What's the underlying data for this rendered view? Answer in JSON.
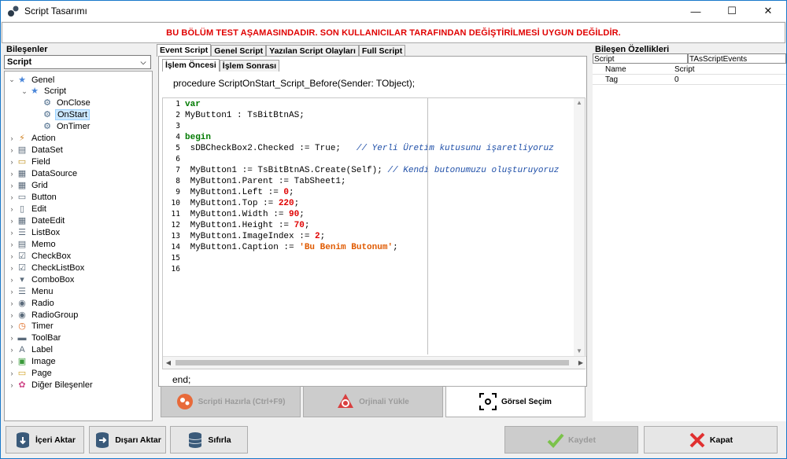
{
  "window": {
    "title": "Script Tasarımı",
    "minimize": "—",
    "maximize": "☐",
    "close": "✕"
  },
  "warning": "BU BÖLÜM TEST AŞAMASINDADIR. SON KULLANICILAR TARAFINDAN DEĞİŞTİRİLMESİ UYGUN DEĞİLDİR.",
  "warning_color": "#e00000",
  "components": {
    "label": "Bileşenler",
    "combo_value": "Script",
    "tree": [
      {
        "label": "Genel",
        "level": 0,
        "expanded": true,
        "icon": "star-icon"
      },
      {
        "label": "Script",
        "level": 1,
        "expanded": true,
        "icon": "star-icon"
      },
      {
        "label": "OnClose",
        "level": 2,
        "icon": "event-icon"
      },
      {
        "label": "OnStart",
        "level": 2,
        "icon": "event-icon",
        "selected": true
      },
      {
        "label": "OnTimer",
        "level": 2,
        "icon": "event-icon"
      },
      {
        "label": "Action",
        "level": 0,
        "icon": "action-icon"
      },
      {
        "label": "DataSet",
        "level": 0,
        "icon": "dataset-icon"
      },
      {
        "label": "Field",
        "level": 0,
        "icon": "field-icon"
      },
      {
        "label": "DataSource",
        "level": 0,
        "icon": "datasource-icon"
      },
      {
        "label": "Grid",
        "level": 0,
        "icon": "grid-icon"
      },
      {
        "label": "Button",
        "level": 0,
        "icon": "button-icon"
      },
      {
        "label": "Edit",
        "level": 0,
        "icon": "edit-icon"
      },
      {
        "label": "DateEdit",
        "level": 0,
        "icon": "dateedit-icon"
      },
      {
        "label": "ListBox",
        "level": 0,
        "icon": "listbox-icon"
      },
      {
        "label": "Memo",
        "level": 0,
        "icon": "memo-icon"
      },
      {
        "label": "CheckBox",
        "level": 0,
        "icon": "checkbox-icon"
      },
      {
        "label": "CheckListBox",
        "level": 0,
        "icon": "checklistbox-icon"
      },
      {
        "label": "ComboBox",
        "level": 0,
        "icon": "combobox-icon"
      },
      {
        "label": "Menu",
        "level": 0,
        "icon": "menu-icon"
      },
      {
        "label": "Radio",
        "level": 0,
        "icon": "radio-icon"
      },
      {
        "label": "RadioGroup",
        "level": 0,
        "icon": "radiogroup-icon"
      },
      {
        "label": "Timer",
        "level": 0,
        "icon": "timer-icon"
      },
      {
        "label": "ToolBar",
        "level": 0,
        "icon": "toolbar-icon"
      },
      {
        "label": "Label",
        "level": 0,
        "icon": "label-icon"
      },
      {
        "label": "Image",
        "level": 0,
        "icon": "image-icon"
      },
      {
        "label": "Page",
        "level": 0,
        "icon": "page-icon"
      },
      {
        "label": "Diğer Bileşenler",
        "level": 0,
        "icon": "other-components-icon"
      }
    ]
  },
  "center": {
    "tabs": [
      "Event Script",
      "Genel Script",
      "Yazılan Script Olayları",
      "Full Script"
    ],
    "subtabs": [
      "İşlem Öncesi",
      "İşlem Sonrası"
    ],
    "procedure": "procedure ScriptOnStart_Script_Before(Sender: TObject);",
    "line_numbers": [
      "1",
      "2",
      "3",
      "4",
      "5",
      "6",
      "7",
      "8",
      "9",
      "10",
      "11",
      "12",
      "13",
      "14",
      "15",
      "16"
    ],
    "code_lines": [
      [
        {
          "t": "var",
          "c": "kw"
        }
      ],
      [
        {
          "t": "MyButton1 : TsBitBtnAS;",
          "c": ""
        }
      ],
      [],
      [
        {
          "t": "begin",
          "c": "kw"
        }
      ],
      [
        {
          "t": " sDBCheckBox2.Checked := True;   ",
          "c": ""
        },
        {
          "t": "// Yerli Üretim kutusunu işaretliyoruz",
          "c": "cmt"
        }
      ],
      [],
      [
        {
          "t": " MyButton1 := TsBitBtnAS.Create(Self); ",
          "c": ""
        },
        {
          "t": "// Kendi butonumuzu oluşturuyoruz",
          "c": "cmt"
        }
      ],
      [
        {
          "t": " MyButton1.Parent := TabSheet1;",
          "c": ""
        }
      ],
      [
        {
          "t": " MyButton1.Left := ",
          "c": ""
        },
        {
          "t": "0",
          "c": "num"
        },
        {
          "t": ";",
          "c": ""
        }
      ],
      [
        {
          "t": " MyButton1.Top := ",
          "c": ""
        },
        {
          "t": "220",
          "c": "num"
        },
        {
          "t": ";",
          "c": ""
        }
      ],
      [
        {
          "t": " MyButton1.Width := ",
          "c": ""
        },
        {
          "t": "90",
          "c": "num"
        },
        {
          "t": ";",
          "c": ""
        }
      ],
      [
        {
          "t": " MyButton1.Height := ",
          "c": ""
        },
        {
          "t": "70",
          "c": "num"
        },
        {
          "t": ";",
          "c": ""
        }
      ],
      [
        {
          "t": " MyButton1.ImageIndex := ",
          "c": ""
        },
        {
          "t": "2",
          "c": "num"
        },
        {
          "t": ";",
          "c": ""
        }
      ],
      [
        {
          "t": " MyButton1.Caption := ",
          "c": ""
        },
        {
          "t": "'Bu Benim Butonum'",
          "c": "str"
        },
        {
          "t": ";",
          "c": ""
        }
      ],
      [],
      []
    ],
    "end_text": "end;",
    "btn_prepare": "Scripti Hazırla (Ctrl+F9)",
    "btn_restore": "Orjinali Yükle",
    "btn_visual": "Görsel Seçim"
  },
  "properties": {
    "label": "Bileşen Özellikleri",
    "header_left": "Script",
    "header_right": "TAsScriptEvents",
    "rows": [
      {
        "name": "Name",
        "value": "Script"
      },
      {
        "name": "Tag",
        "value": "0"
      }
    ]
  },
  "bottom": {
    "import": "İçeri Aktar",
    "export": "Dışarı Aktar",
    "reset": "Sıfırla",
    "save": "Kaydet",
    "close": "Kapat"
  }
}
